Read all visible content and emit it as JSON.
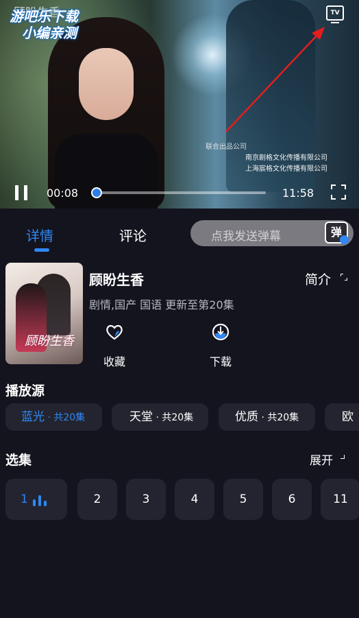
{
  "player": {
    "overlay_line1": "游吧乐下载",
    "overlay_line2": "小编亲测",
    "episode_title": "顾盼生香",
    "tv_icon_label": "TV",
    "credit_company": "联合出品公司",
    "credit_line1": "南京剧格文化传播有限公司",
    "credit_line2": "上海宸格文化传播有限公司",
    "current_time": "00:08",
    "total_time": "11:58",
    "progress": 0.011
  },
  "tabs": {
    "details": "详情",
    "comments": "评论",
    "danmaku_placeholder": "点我发送弹幕",
    "danmaku_icon": "弹"
  },
  "show": {
    "title": "顾盼生香",
    "synopsis_label": "简介",
    "meta": "剧情,国产 国语 更新至第20集",
    "poster_title": "顾盼生香",
    "favorite_label": "收藏",
    "download_label": "下载"
  },
  "sources": {
    "title": "播放源",
    "items": [
      {
        "name": "蓝光",
        "count": " · 共20集",
        "active": true
      },
      {
        "name": "天堂",
        "count": " · 共20集",
        "active": false
      },
      {
        "name": "优质",
        "count": " · 共20集",
        "active": false
      },
      {
        "name": "欧",
        "count": "",
        "active": false
      }
    ]
  },
  "episodes": {
    "title": "选集",
    "expand_label": "展开",
    "items": [
      "1",
      "2",
      "3",
      "4",
      "5",
      "6",
      "11"
    ]
  },
  "colors": {
    "accent": "#2f88f5",
    "background": "#14141f",
    "chip": "#23242f"
  }
}
